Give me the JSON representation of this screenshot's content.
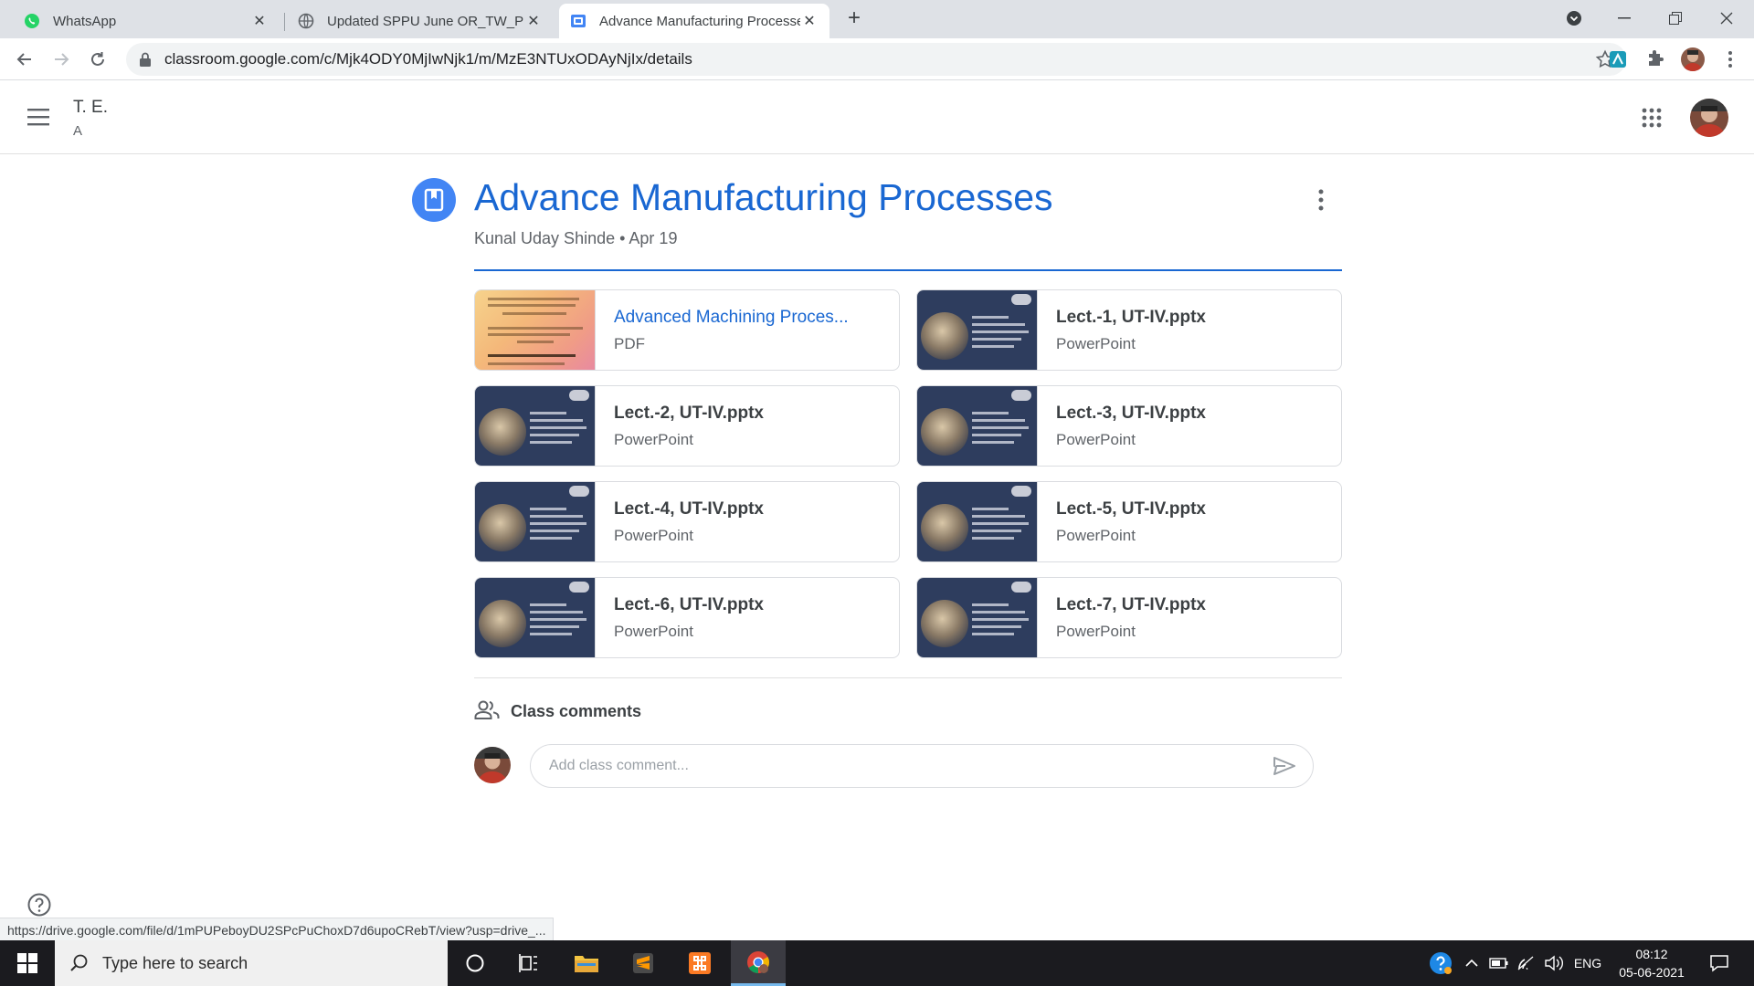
{
  "browser": {
    "tabs": [
      {
        "title": "WhatsApp",
        "active": false
      },
      {
        "title": "Updated SPPU June OR_TW_PR e",
        "active": false
      },
      {
        "title": "Advance Manufacturing Processe",
        "active": true
      }
    ],
    "url": "classroom.google.com/c/Mjk4ODY0MjIwNjk1/m/MzE3NTUxODAyNjIx/details",
    "status_url": "https://drive.google.com/file/d/1mPUPeboyDU2SPcPuChoxD7d6upoCRebT/view?usp=drive_..."
  },
  "classroom": {
    "class_name": "T. E.",
    "section": "A",
    "material": {
      "title": "Advance Manufacturing Processes",
      "meta": "Kunal Uday Shinde • Apr 19"
    },
    "attachments": [
      {
        "name": "Advanced Machining Proces...",
        "type": "PDF",
        "kind": "pdf"
      },
      {
        "name": "Lect.-1, UT-IV.pptx",
        "type": "PowerPoint",
        "kind": "ppt"
      },
      {
        "name": "Lect.-2, UT-IV.pptx",
        "type": "PowerPoint",
        "kind": "ppt"
      },
      {
        "name": "Lect.-3, UT-IV.pptx",
        "type": "PowerPoint",
        "kind": "ppt"
      },
      {
        "name": "Lect.-4, UT-IV.pptx",
        "type": "PowerPoint",
        "kind": "ppt"
      },
      {
        "name": "Lect.-5, UT-IV.pptx",
        "type": "PowerPoint",
        "kind": "ppt"
      },
      {
        "name": "Lect.-6, UT-IV.pptx",
        "type": "PowerPoint",
        "kind": "ppt"
      },
      {
        "name": "Lect.-7, UT-IV.pptx",
        "type": "PowerPoint",
        "kind": "ppt"
      }
    ],
    "comments": {
      "heading": "Class comments",
      "placeholder": "Add class comment..."
    }
  },
  "taskbar": {
    "search_placeholder": "Type here to search",
    "language": "ENG",
    "time": "08:12",
    "date": "05-06-2021"
  },
  "colors": {
    "accent": "#1967d2",
    "assignment_icon": "#4285f4"
  }
}
